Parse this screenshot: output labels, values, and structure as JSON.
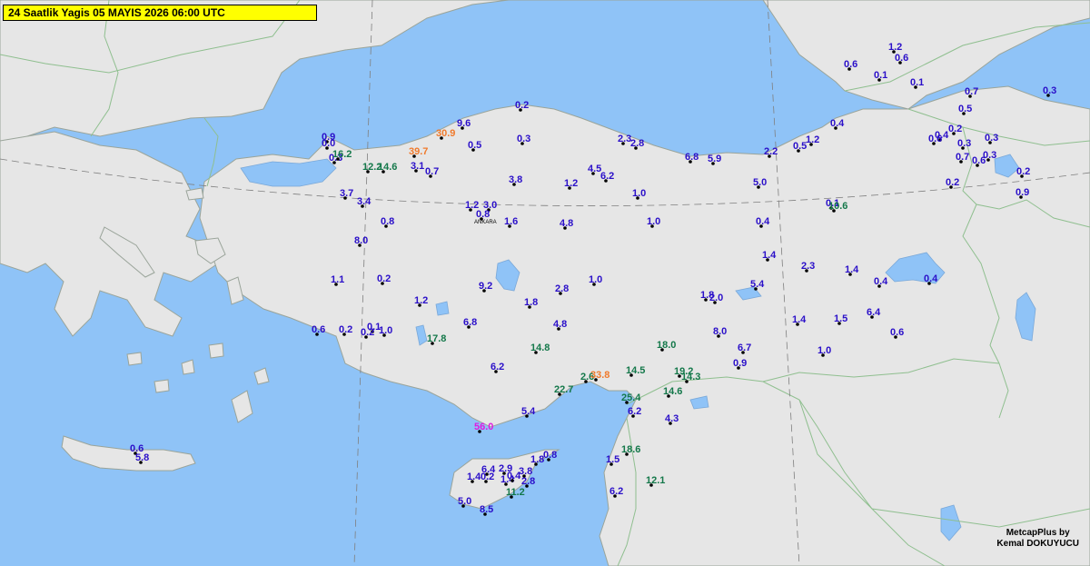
{
  "header": {
    "title": "24 Saatlik Yagis 05  MAYIS  2026  06:00 UTC"
  },
  "credit": {
    "line1": "MetcapPlus by",
    "line2": "Kemal DOKUYUCU"
  },
  "city_label": "ANKARA",
  "colors": {
    "sea": "#8fc3f7",
    "land": "#e6e6e6",
    "border": "#8fbf8f",
    "graticule": "#7f7f7f",
    "low": "#2a0fc9",
    "mid": "#14784a",
    "high": "#f07a2c",
    "extreme": "#e11adf"
  },
  "stations": [
    {
      "v": "1.2",
      "c": "low"
    },
    {
      "v": "0.6",
      "c": "low"
    },
    {
      "v": "0.6",
      "c": "low"
    },
    {
      "v": "0.1",
      "c": "low"
    },
    {
      "v": "0.1",
      "c": "low"
    },
    {
      "v": "0.7",
      "c": "low"
    },
    {
      "v": "0.3",
      "c": "low"
    },
    {
      "v": "0.5",
      "c": "low"
    },
    {
      "v": "0.3",
      "c": "low"
    },
    {
      "v": "0.2",
      "c": "low"
    },
    {
      "v": "0.4",
      "c": "low"
    },
    {
      "v": "0.6",
      "c": "low"
    },
    {
      "v": "0.3",
      "c": "low"
    },
    {
      "v": "0.7",
      "c": "low"
    },
    {
      "v": "0.3",
      "c": "low"
    },
    {
      "v": "0.6",
      "c": "low"
    },
    {
      "v": "0.2",
      "c": "low"
    },
    {
      "v": "0.2",
      "c": "low"
    },
    {
      "v": "0.9",
      "c": "low"
    },
    {
      "v": "0.2",
      "c": "low"
    },
    {
      "v": "9.6",
      "c": "low"
    },
    {
      "v": "30.9",
      "c": "high"
    },
    {
      "v": "0.5",
      "c": "low"
    },
    {
      "v": "0.3",
      "c": "low"
    },
    {
      "v": "39.7",
      "c": "high"
    },
    {
      "v": "2.3",
      "c": "low"
    },
    {
      "v": "2.8",
      "c": "low"
    },
    {
      "v": "6.8",
      "c": "low"
    },
    {
      "v": "5.9",
      "c": "low"
    },
    {
      "v": "2.2",
      "c": "low"
    },
    {
      "v": "0.5",
      "c": "low"
    },
    {
      "v": "1.2",
      "c": "low"
    },
    {
      "v": "0.4",
      "c": "low"
    },
    {
      "v": "0.9",
      "c": "low"
    },
    {
      "v": "0.0",
      "c": "low"
    },
    {
      "v": "0.3",
      "c": "low"
    },
    {
      "v": "16.2",
      "c": "mid"
    },
    {
      "v": "12.2",
      "c": "mid"
    },
    {
      "v": "14.6",
      "c": "mid"
    },
    {
      "v": "3.1",
      "c": "low"
    },
    {
      "v": "0.7",
      "c": "low"
    },
    {
      "v": "3.8",
      "c": "low"
    },
    {
      "v": "1.2",
      "c": "low"
    },
    {
      "v": "4.5",
      "c": "low"
    },
    {
      "v": "6.2",
      "c": "low"
    },
    {
      "v": "1.0",
      "c": "low"
    },
    {
      "v": "5.0",
      "c": "low"
    },
    {
      "v": "3.7",
      "c": "low"
    },
    {
      "v": "3.4",
      "c": "low"
    },
    {
      "v": "1.2",
      "c": "low"
    },
    {
      "v": "3.0",
      "c": "low"
    },
    {
      "v": "0.8",
      "c": "low"
    },
    {
      "v": "0.8",
      "c": "low"
    },
    {
      "v": "1.6",
      "c": "low"
    },
    {
      "v": "4.8",
      "c": "low"
    },
    {
      "v": "1.0",
      "c": "low"
    },
    {
      "v": "0.4",
      "c": "low"
    },
    {
      "v": "0.1",
      "c": "low"
    },
    {
      "v": "10.6",
      "c": "mid"
    },
    {
      "v": "8.0",
      "c": "low"
    },
    {
      "v": "1.4",
      "c": "low"
    },
    {
      "v": "2.3",
      "c": "low"
    },
    {
      "v": "1.4",
      "c": "low"
    },
    {
      "v": "0.4",
      "c": "low"
    },
    {
      "v": "0.4",
      "c": "low"
    },
    {
      "v": "1.1",
      "c": "low"
    },
    {
      "v": "0.2",
      "c": "low"
    },
    {
      "v": "9.2",
      "c": "low"
    },
    {
      "v": "2.8",
      "c": "low"
    },
    {
      "v": "1.0",
      "c": "low"
    },
    {
      "v": "1.2",
      "c": "low"
    },
    {
      "v": "1.8",
      "c": "low"
    },
    {
      "v": "1.8",
      "c": "low"
    },
    {
      "v": "2.0",
      "c": "low"
    },
    {
      "v": "5.4",
      "c": "low"
    },
    {
      "v": "1.4",
      "c": "low"
    },
    {
      "v": "1.5",
      "c": "low"
    },
    {
      "v": "6.4",
      "c": "low"
    },
    {
      "v": "0.6",
      "c": "low"
    },
    {
      "v": "0.6",
      "c": "low"
    },
    {
      "v": "0.2",
      "c": "low"
    },
    {
      "v": "0.1",
      "c": "low"
    },
    {
      "v": "0.2",
      "c": "low"
    },
    {
      "v": "1.0",
      "c": "low"
    },
    {
      "v": "6.8",
      "c": "low"
    },
    {
      "v": "4.8",
      "c": "low"
    },
    {
      "v": "17.8",
      "c": "mid"
    },
    {
      "v": "14.8",
      "c": "mid"
    },
    {
      "v": "18.0",
      "c": "mid"
    },
    {
      "v": "8.0",
      "c": "low"
    },
    {
      "v": "6.7",
      "c": "low"
    },
    {
      "v": "0.9",
      "c": "low"
    },
    {
      "v": "1.0",
      "c": "low"
    },
    {
      "v": "6.2",
      "c": "low"
    },
    {
      "v": "2.6",
      "c": "mid"
    },
    {
      "v": "33.8",
      "c": "high"
    },
    {
      "v": "14.5",
      "c": "mid"
    },
    {
      "v": "19.2",
      "c": "mid"
    },
    {
      "v": "14.3",
      "c": "mid"
    },
    {
      "v": "22.7",
      "c": "mid"
    },
    {
      "v": "14.6",
      "c": "mid"
    },
    {
      "v": "25.4",
      "c": "mid"
    },
    {
      "v": "6.2",
      "c": "low"
    },
    {
      "v": "5.4",
      "c": "low"
    },
    {
      "v": "4.3",
      "c": "low"
    },
    {
      "v": "56.0",
      "c": "extreme"
    },
    {
      "v": "18.6",
      "c": "mid"
    },
    {
      "v": "1.5",
      "c": "low"
    },
    {
      "v": "0.6",
      "c": "low"
    },
    {
      "v": "5.8",
      "c": "low"
    },
    {
      "v": "6.4",
      "c": "low"
    },
    {
      "v": "2.9",
      "c": "low"
    },
    {
      "v": "1.4",
      "c": "low"
    },
    {
      "v": "0.2",
      "c": "low"
    },
    {
      "v": "1.4",
      "c": "low"
    },
    {
      "v": "0.4",
      "c": "low"
    },
    {
      "v": "3.8",
      "c": "low"
    },
    {
      "v": "2.8",
      "c": "low"
    },
    {
      "v": "1.8",
      "c": "low"
    },
    {
      "v": "0.8",
      "c": "low"
    },
    {
      "v": "11.2",
      "c": "mid"
    },
    {
      "v": "5.0",
      "c": "low"
    },
    {
      "v": "8.5",
      "c": "low"
    },
    {
      "v": "6.2",
      "c": "low"
    },
    {
      "v": "12.1",
      "c": "mid"
    }
  ]
}
